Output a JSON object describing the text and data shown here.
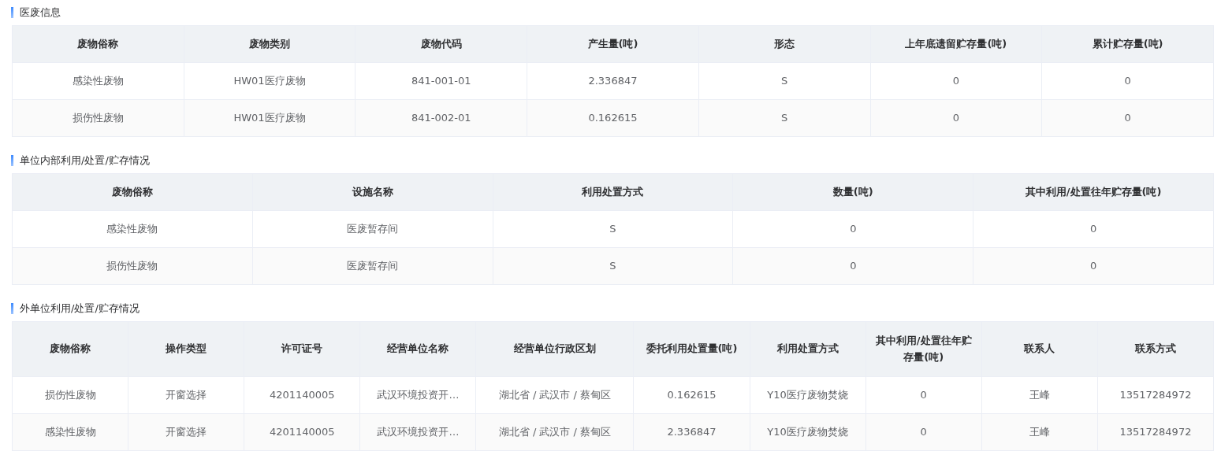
{
  "sections": [
    {
      "title": "医废信息",
      "table": {
        "columns": [
          "废物俗称",
          "废物类别",
          "废物代码",
          "产生量(吨)",
          "形态",
          "上年底遗留贮存量(吨)",
          "累计贮存量(吨)"
        ],
        "rows": [
          [
            "感染性废物",
            "HW01医疗废物",
            "841-001-01",
            "2.336847",
            "S",
            "0",
            "0"
          ],
          [
            "损伤性废物",
            "HW01医疗废物",
            "841-002-01",
            "0.162615",
            "S",
            "0",
            "0"
          ]
        ]
      }
    },
    {
      "title": "单位内部利用/处置/贮存情况",
      "table": {
        "columns": [
          "废物俗称",
          "设施名称",
          "利用处置方式",
          "数量(吨)",
          "其中利用/处置往年贮存量(吨)"
        ],
        "rows": [
          [
            "感染性废物",
            "医废暂存间",
            "S",
            "0",
            "0"
          ],
          [
            "损伤性废物",
            "医废暂存间",
            "S",
            "0",
            "0"
          ]
        ]
      }
    },
    {
      "title": "外单位利用/处置/贮存情况",
      "table": {
        "columns": [
          "废物俗称",
          "操作类型",
          "许可证号",
          "经营单位名称",
          "经营单位行政区划",
          "委托利用处置量(吨)",
          "利用处置方式",
          "其中利用/处置往年贮存量(吨)",
          "联系人",
          "联系方式"
        ],
        "rows": [
          [
            "损伤性废物",
            "开窗选择",
            "4201140005",
            "武汉环境投资开…",
            "湖北省 / 武汉市 / 蔡甸区",
            "0.162615",
            "Y10医疗废物焚烧",
            "0",
            "王峰",
            "13517284972"
          ],
          [
            "感染性废物",
            "开窗选择",
            "4201140005",
            "武汉环境投资开…",
            "湖北省 / 武汉市 / 蔡甸区",
            "2.336847",
            "Y10医疗废物焚烧",
            "0",
            "王峰",
            "13517284972"
          ]
        ]
      }
    }
  ]
}
